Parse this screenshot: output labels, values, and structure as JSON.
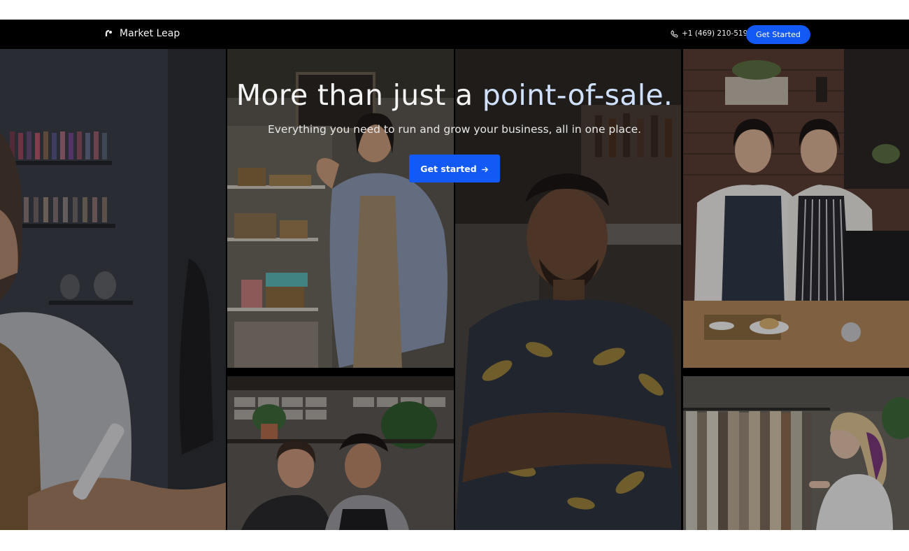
{
  "navbar": {
    "brand_name": "Market Leap",
    "phone": "+1 (469) 210-5193",
    "cta_label": "Get Started"
  },
  "hero": {
    "headline_main": "More than just a ",
    "headline_accent": "point-of-sale.",
    "subhead": "Everything you need to run and grow your business, all in one place.",
    "cta_label": "Get started"
  },
  "colors": {
    "accent_blue": "#1259f5",
    "headline_accent": "#cfe1ff",
    "navbar_bg": "#000000"
  },
  "icons": {
    "brand": "market-leap-logo-icon",
    "phone": "phone-icon",
    "cta_arrow": "arrow-right-icon"
  },
  "gallery": {
    "tiles": [
      "nail-salon-photo",
      "shop-owner-photo",
      "smiling-man-photo",
      "cafe-owners-photo",
      "coffee-shop-workers-photo",
      "clothing-boutique-photo"
    ]
  }
}
